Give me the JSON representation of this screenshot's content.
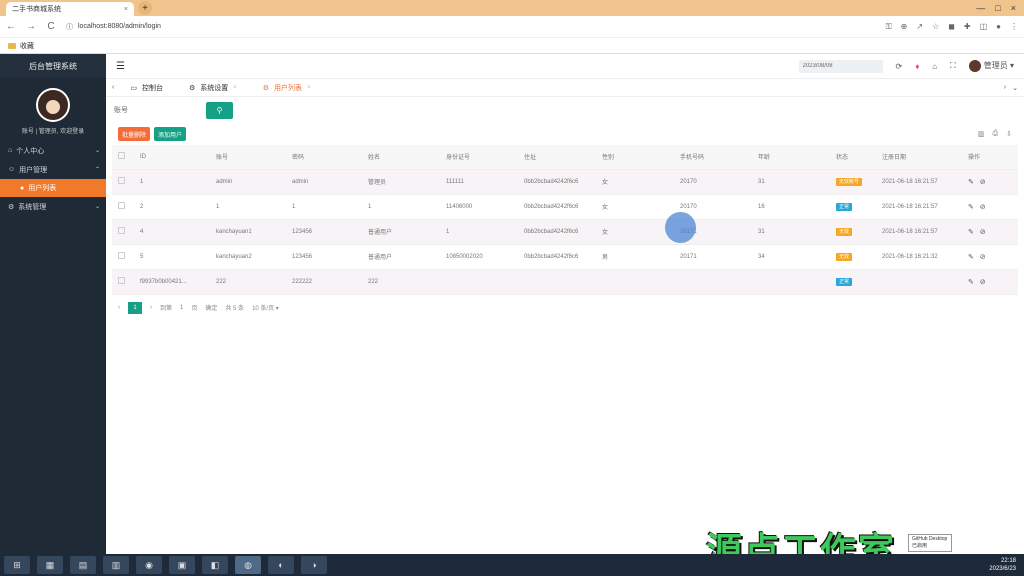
{
  "browser": {
    "tab_title": "二手书商城系统",
    "tab_close": "×",
    "new_tab": "+",
    "url": "localhost:8080/admin/login",
    "bookmark": "收藏",
    "nav": {
      "back": "←",
      "forward": "→",
      "reload": "C"
    },
    "window_controls": {
      "min": "—",
      "max": "□",
      "close": "×"
    }
  },
  "sidebar": {
    "title": "后台管理系统",
    "user_line": "账号 | 管理员, 欢迎登录",
    "menu": [
      {
        "label": "个人中心",
        "chevron": "⌄"
      },
      {
        "label": "用户管理",
        "chevron": "⌃"
      },
      {
        "label": "系统管理",
        "chevron": "⌄"
      }
    ],
    "submenu_active": "用户列表"
  },
  "topbar": {
    "menu_icon": "☰",
    "search_value": "2023/08/08",
    "username": "管理员 ▾"
  },
  "page_tabs": [
    {
      "label": "控制台"
    },
    {
      "label": "系统设置"
    },
    {
      "label": "用户列表"
    }
  ],
  "search": {
    "label": "账号",
    "button_icon": "⚲"
  },
  "actions": {
    "batch_delete": "批量删除",
    "add_user": "添加用户"
  },
  "table": {
    "headers": [
      "ID",
      "账号",
      "密码",
      "姓名",
      "身份证号",
      "住址",
      "性别",
      "手机号码",
      "年龄",
      "状态",
      "注册日期",
      "操作"
    ],
    "rows": [
      {
        "id": "1",
        "account": "admin",
        "password": "admin",
        "name": "管理员",
        "idcard": "111111",
        "address": "0bb2bcbad4242f6c6",
        "gender": "女",
        "phone": "20170",
        "age": "31",
        "status": "无效账号",
        "status_color": "#f5a623",
        "date": "2021-06-18 16:21:57",
        "ops": "✎ ⊘"
      },
      {
        "id": "2",
        "account": "1",
        "password": "1",
        "name": "1",
        "idcard": "11406000",
        "address": "0bb2bcbad4242f6c6",
        "gender": "女",
        "phone": "20170",
        "age": "16",
        "status": "正常",
        "status_color": "#2aa7d8",
        "date": "2021-06-18 16:21:57",
        "ops": "✎ ⊘"
      },
      {
        "id": "4",
        "account": "kanchayuan1",
        "password": "123456",
        "name": "普通用户",
        "idcard": "1",
        "address": "0bb2bcbad4242f6c6",
        "gender": "女",
        "phone": "20171",
        "age": "31",
        "status": "无效",
        "status_color": "#f5a623",
        "date": "2021-06-18 16:21:57",
        "ops": "✎ ⊘"
      },
      {
        "id": "5",
        "account": "kanchayuan2",
        "password": "123456",
        "name": "普通用户",
        "idcard": "10850002020",
        "address": "0bb2bcbad4242f6c6",
        "gender": "男",
        "phone": "20171",
        "age": "34",
        "status": "无效",
        "status_color": "#f5a623",
        "date": "2021-06-18 16:21:32",
        "ops": "✎ ⊘"
      },
      {
        "id": "f9937b0b00421...",
        "account": "222",
        "password": "222222",
        "name": "222",
        "idcard": "",
        "address": "",
        "gender": "",
        "phone": "",
        "age": "",
        "status": "正常",
        "status_color": "#2aa7d8",
        "date": "",
        "ops": "✎ ⊘"
      }
    ]
  },
  "pager": {
    "prev": "‹",
    "current": "1",
    "next": "›",
    "goto_label": "到第",
    "page_input": "1",
    "page_unit": "页",
    "confirm": "确定",
    "total": "共 5 条",
    "page_size": "10 条/页 ▾"
  },
  "overlay": {
    "watermark": "源点工作室",
    "tooltip": "GitHub Desktop 已启用"
  },
  "taskbar": {
    "items": [
      "⊞",
      "▦",
      "▤",
      "▥",
      "◉",
      "▣",
      "◧",
      "◍",
      "◐",
      "◑"
    ],
    "time": "22:18",
    "date": "2023/6/23"
  }
}
